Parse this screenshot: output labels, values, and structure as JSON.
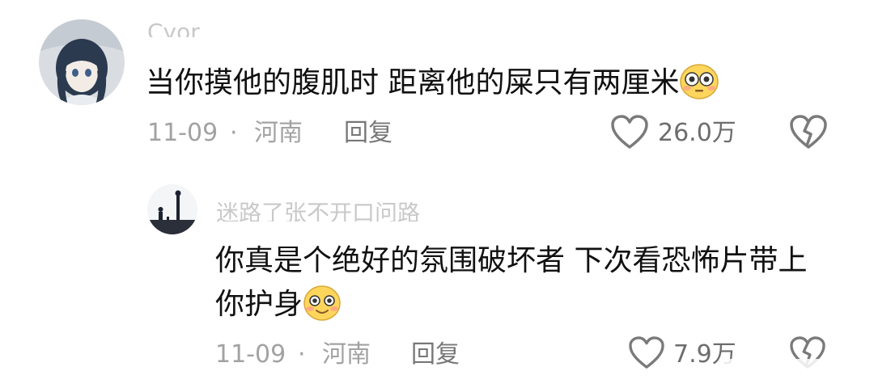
{
  "comments": [
    {
      "username": "Cyor",
      "text": "当你摸他的腹肌时 距离他的屎只有两厘米",
      "emoji_icon": "flushed-face-emoji",
      "date": "11-09",
      "location": "河南",
      "reply_label": "回复",
      "like_count": "26.0万",
      "dislike_icon": "broken-heart-icon"
    },
    {
      "username": "迷路了张不开口问路",
      "text_line1": "你真是个绝好的氛围破坏者  下次看恐怖片带上",
      "text_line2": "你护身",
      "emoji_icon": "blushing-smile-emoji",
      "date": "11-09",
      "location": "河南",
      "reply_label": "回复",
      "like_count": "7.9万",
      "dislike_icon": "broken-heart-icon"
    }
  ],
  "separator": "·",
  "colors": {
    "text": "#111111",
    "meta": "#a2a2a2",
    "icon": "#7a7a7a",
    "emoji_face": "#ffd65c"
  }
}
